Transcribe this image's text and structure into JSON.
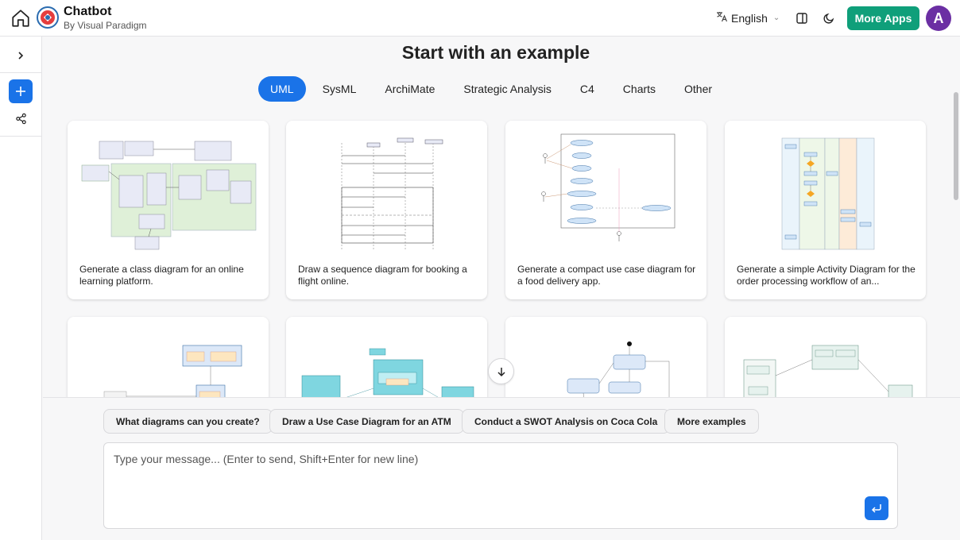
{
  "header": {
    "app_title": "Chatbot",
    "app_subtitle": "By Visual Paradigm",
    "language": "English",
    "more_apps_label": "More Apps",
    "avatar_initial": "A"
  },
  "main": {
    "heading": "Start with an example",
    "tabs": [
      {
        "label": "UML",
        "active": true
      },
      {
        "label": "SysML",
        "active": false
      },
      {
        "label": "ArchiMate",
        "active": false
      },
      {
        "label": "Strategic Analysis",
        "active": false
      },
      {
        "label": "C4",
        "active": false
      },
      {
        "label": "Charts",
        "active": false
      },
      {
        "label": "Other",
        "active": false
      }
    ],
    "cards": [
      {
        "caption": "Generate a class diagram for an online learning platform."
      },
      {
        "caption": "Draw a sequence diagram for booking a flight online."
      },
      {
        "caption": "Generate a compact use case diagram for a food delivery app."
      },
      {
        "caption": "Generate a simple Activity Diagram for the order processing workflow of an..."
      },
      {
        "caption": ""
      },
      {
        "caption": ""
      },
      {
        "caption": ""
      },
      {
        "caption": ""
      }
    ]
  },
  "suggestions": [
    "What diagrams can you create?",
    "Draw a Use Case Diagram for an ATM",
    "Conduct a SWOT Analysis on Coca Cola",
    "More examples"
  ],
  "composer": {
    "placeholder": "Type your message... (Enter to send, Shift+Enter for new line)"
  },
  "colors": {
    "accent": "#1a73e8",
    "more_apps": "#0f9f7a",
    "avatar": "#6b2fa3"
  }
}
